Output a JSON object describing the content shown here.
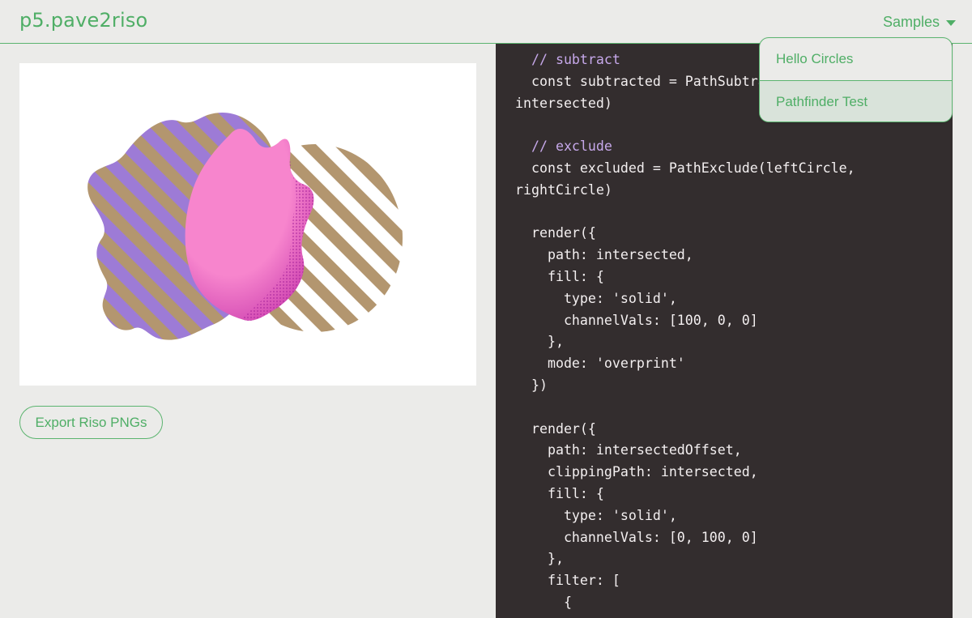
{
  "header": {
    "title": "p5.pave2riso",
    "samples_label": "Samples"
  },
  "dropdown": {
    "items": [
      {
        "label": "Hello Circles",
        "selected": false
      },
      {
        "label": "Pathfinder Test",
        "selected": true
      }
    ]
  },
  "actions": {
    "export_label": "Export Riso PNGs"
  },
  "code": {
    "lines": [
      "  // subtract",
      "  const subtracted = PathSubtract(rightCircle,",
      "intersected)",
      "",
      "  // exclude",
      "  const excluded = PathExclude(leftCircle,",
      "rightCircle)",
      "",
      "  render({",
      "    path: intersected,",
      "    fill: {",
      "      type: 'solid',",
      "      channelVals: [100, 0, 0]",
      "    },",
      "    mode: 'overprint'",
      "  })",
      "",
      "  render({",
      "    path: intersectedOffset,",
      "    clippingPath: intersected,",
      "    fill: {",
      "      type: 'solid',",
      "      channelVals: [0, 100, 0]",
      "    },",
      "    filter: [",
      "      {"
    ]
  },
  "colors": {
    "accent": "#4fae66",
    "code_bg": "#332d2e",
    "code_text": "#f3eff0",
    "code_comment": "#c6a8ea",
    "riso_purple": "#9d7bd6",
    "riso_tan": "#b3966f",
    "riso_pink": "#f785cd",
    "riso_magenta": "#a8239c"
  }
}
